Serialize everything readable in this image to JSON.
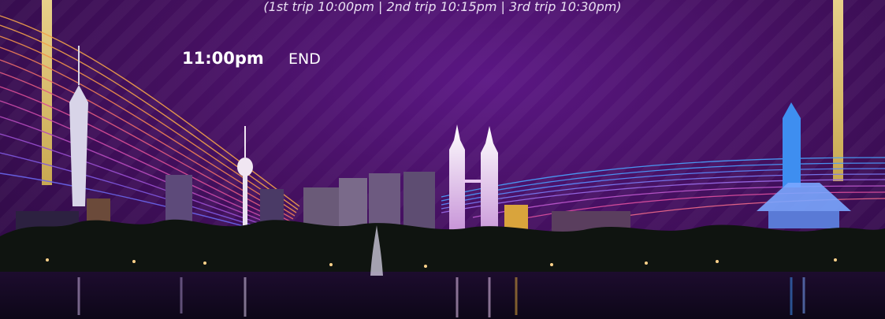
{
  "schedule": {
    "trip_note": "(1st trip 10:00pm | 2nd trip 10:15pm | 3rd trip 10:30pm)",
    "rows": [
      {
        "time": "11:00pm",
        "desc": "END"
      }
    ]
  },
  "colors": {
    "background": "#44105f",
    "gold_accent": "#d9bd6a",
    "neon_orange": "#f2a14a",
    "neon_pink": "#e0508f",
    "neon_blue": "#4aa3ff"
  }
}
